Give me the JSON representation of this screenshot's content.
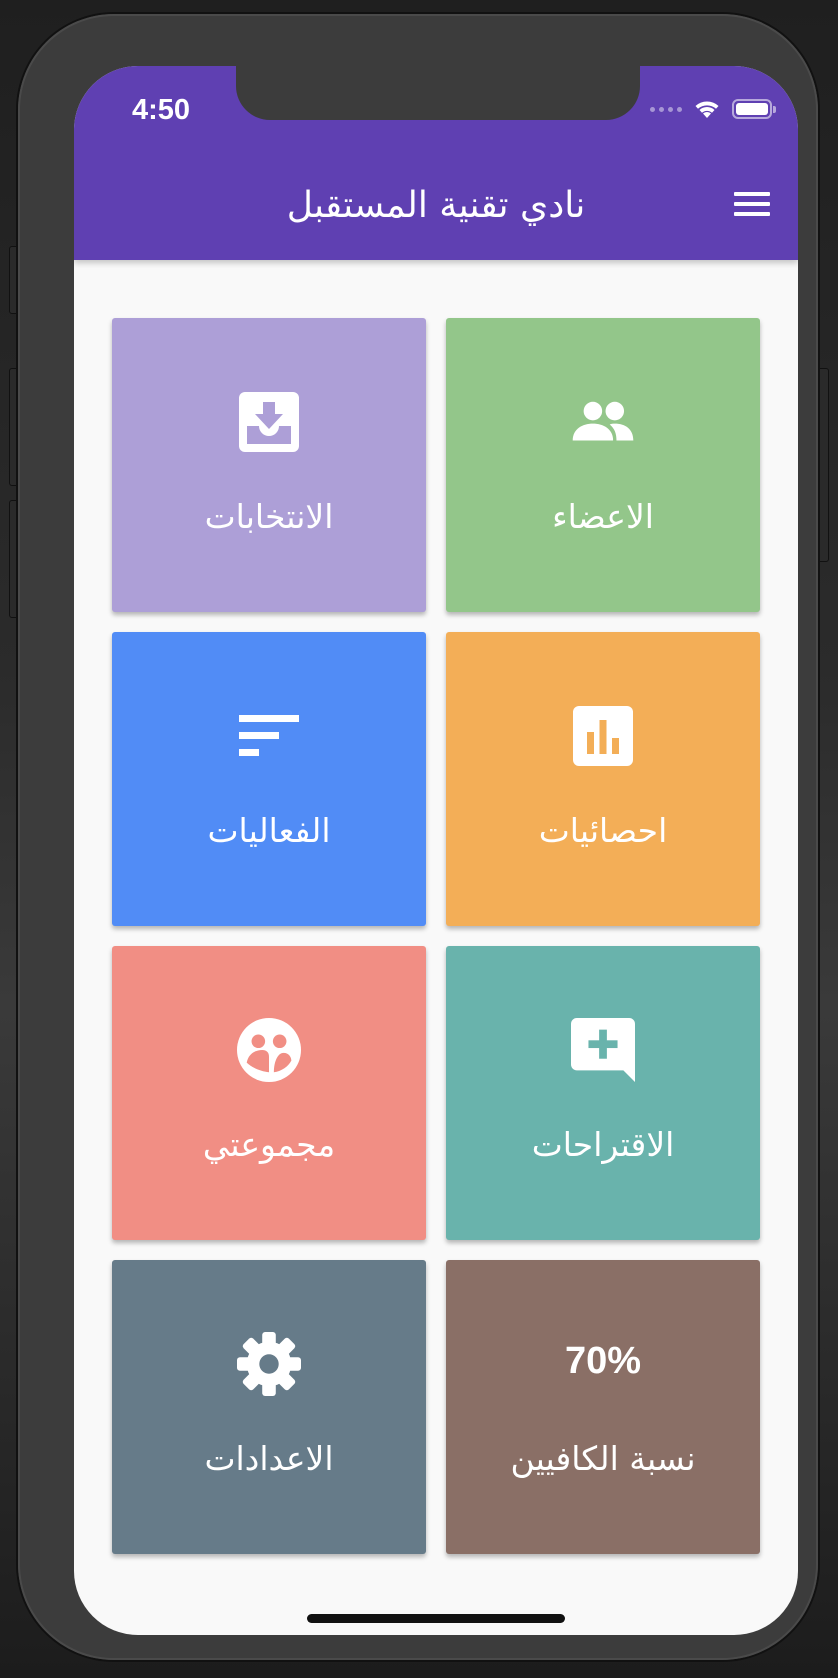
{
  "status_bar": {
    "time": "4:50"
  },
  "app_bar": {
    "title": "نادي تقنية المستقبل",
    "menu_icon": "hamburger-menu-icon",
    "color": "#5f40b2"
  },
  "tiles": [
    {
      "label": "الاعضاء",
      "icon": "group-icon",
      "color": "#93c68a"
    },
    {
      "label": "الانتخابات",
      "icon": "move-to-inbox-icon",
      "color": "#ad9fd7"
    },
    {
      "label": "احصائيات",
      "icon": "bar-chart-icon",
      "color": "#f3ae57"
    },
    {
      "label": "الفعاليات",
      "icon": "sort-icon",
      "color": "#518cf6"
    },
    {
      "label": "الاقتراحات",
      "icon": "add-comment-icon",
      "color": "#69b3ac"
    },
    {
      "label": "مجموعتي",
      "icon": "group-work-icon",
      "color": "#f18e84"
    },
    {
      "label": "نسبة الكافيين",
      "value": "70%",
      "color": "#8a6f66"
    },
    {
      "label": "الاعدادات",
      "icon": "settings-gear-icon",
      "color": "#667b89"
    }
  ]
}
